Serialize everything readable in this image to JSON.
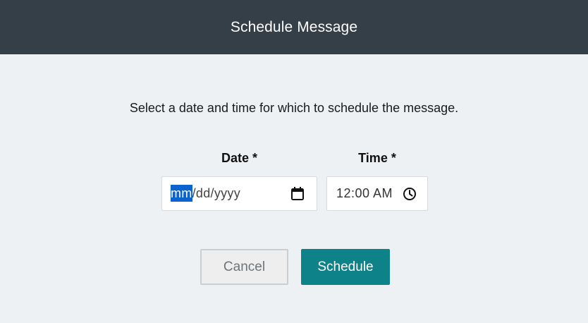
{
  "dialog": {
    "title": "Schedule Message",
    "instructions": "Select a date and time for which to schedule the message."
  },
  "date_field": {
    "label": "Date *",
    "selected_segment": "mm",
    "remaining_placeholder": "/dd/yyyy",
    "icon": "calendar-icon"
  },
  "time_field": {
    "label": "Time *",
    "value": "12:00 AM",
    "icon": "clock-icon"
  },
  "actions": {
    "cancel_label": "Cancel",
    "schedule_label": "Schedule"
  },
  "colors": {
    "header_bg": "#343f48",
    "page_bg": "#eef1f4",
    "primary": "#0e8289",
    "selection": "#0b63ce"
  }
}
